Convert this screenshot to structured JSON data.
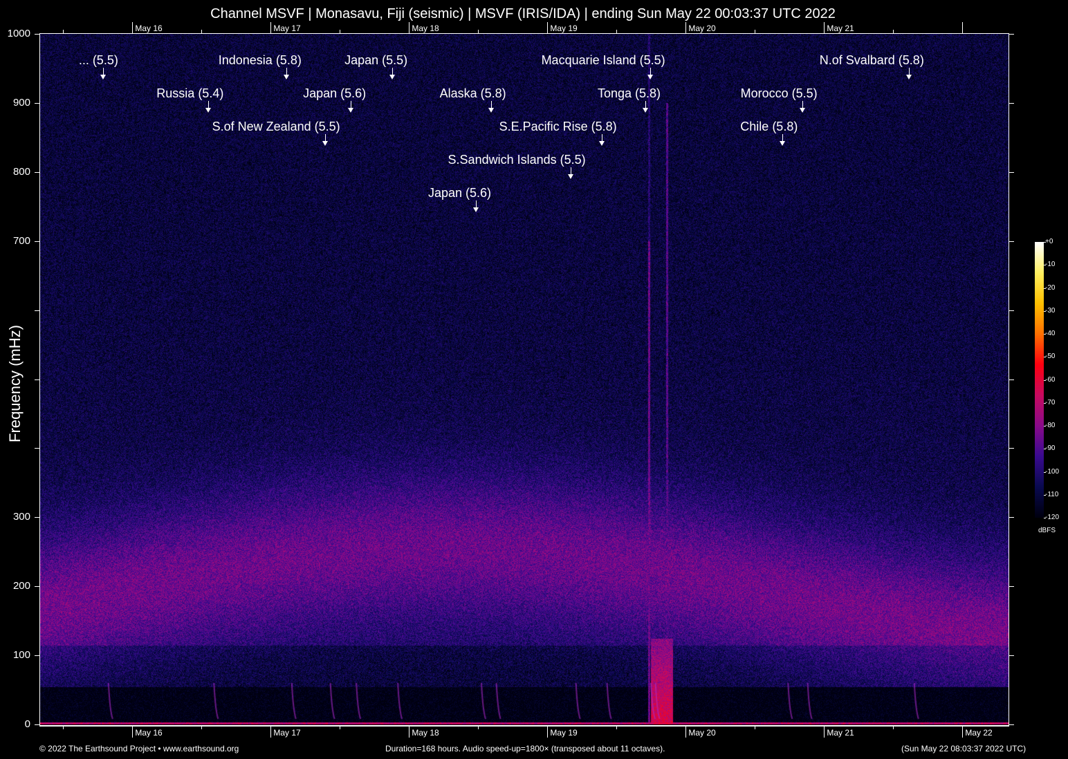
{
  "title": "Channel MSVF | Monasavu, Fiji (seismic) | MSVF (IRIS/IDA) | ending Sun May 22 00:03:37 UTC 2022",
  "footer": {
    "left": "© 2022 The Earthsound Project • www.earthsound.org",
    "center": "Duration=168 hours. Audio speed-up=1800× (transposed about 11 octaves).",
    "right": "(Sun May 22 08:03:37 2022 UTC)"
  },
  "chart_data": {
    "type": "heatmap",
    "title": "Channel MSVF | Monasavu, Fiji (seismic) | MSVF (IRIS/IDA) | ending Sun May 22 00:03:37 UTC 2022",
    "ylabel": "Frequency (mHz)",
    "ylim": [
      0,
      1000
    ],
    "y_ticks": [
      0,
      100,
      200,
      300,
      400,
      500,
      600,
      700,
      800,
      900,
      1000
    ],
    "y_tick_labels": [
      "0",
      "100",
      "200",
      "300",
      "",
      "",
      "",
      "700",
      "800",
      "900",
      "1000"
    ],
    "x_duration_hours": 168,
    "x_first_day_offset_hours": 16,
    "x_tick_labels_bottom": [
      "May 16",
      "May 17",
      "May 18",
      "May 19",
      "May 20",
      "May 21",
      "May 22"
    ],
    "x_tick_labels_top": [
      "May 16",
      "May 17",
      "May 18",
      "May 19",
      "May 20",
      "May 21"
    ],
    "colorbar": {
      "label": "dBFS",
      "range": [
        -120,
        0
      ],
      "tick_labels": [
        "+0",
        "-10",
        "-20",
        "-30",
        "-40",
        "-50",
        "-60",
        "-70",
        "-80",
        "-90",
        "-100",
        "-110",
        "-120"
      ],
      "stops": [
        "#000010",
        "#0a0a50",
        "#3a0a90",
        "#8a0a8a",
        "#c80a60",
        "#ff0010",
        "#ff7000",
        "#ffc000",
        "#fff060",
        "#ffffff"
      ]
    },
    "events": [
      {
        "label": "... (5.5)",
        "hour": 10.9
      },
      {
        "label": "Indonesia (5.8)",
        "hour": 42.7
      },
      {
        "label": "Japan (5.5)",
        "hour": 61.1
      },
      {
        "label": "Macquarie Island (5.5)",
        "hour": 105.8
      },
      {
        "label": "N.of Svalbard (5.8)",
        "hour": 150.7
      },
      {
        "label": "Russia (5.4)",
        "hour": 29.2
      },
      {
        "label": "Japan (5.6)",
        "hour": 53.9
      },
      {
        "label": "Alaska (5.8)",
        "hour": 78.2
      },
      {
        "label": "Tonga (5.8)",
        "hour": 105.0
      },
      {
        "label": "Morocco (5.5)",
        "hour": 132.2
      },
      {
        "label": "S.of New Zealand (5.5)",
        "hour": 49.4
      },
      {
        "label": "S.E.Pacific Rise (5.8)",
        "hour": 97.4
      },
      {
        "label": "Chile (5.8)",
        "hour": 128.8
      },
      {
        "label": "S.Sandwich Islands (5.5)",
        "hour": 92.0
      },
      {
        "label": "Japan (5.6)",
        "hour": 75.6
      }
    ]
  }
}
